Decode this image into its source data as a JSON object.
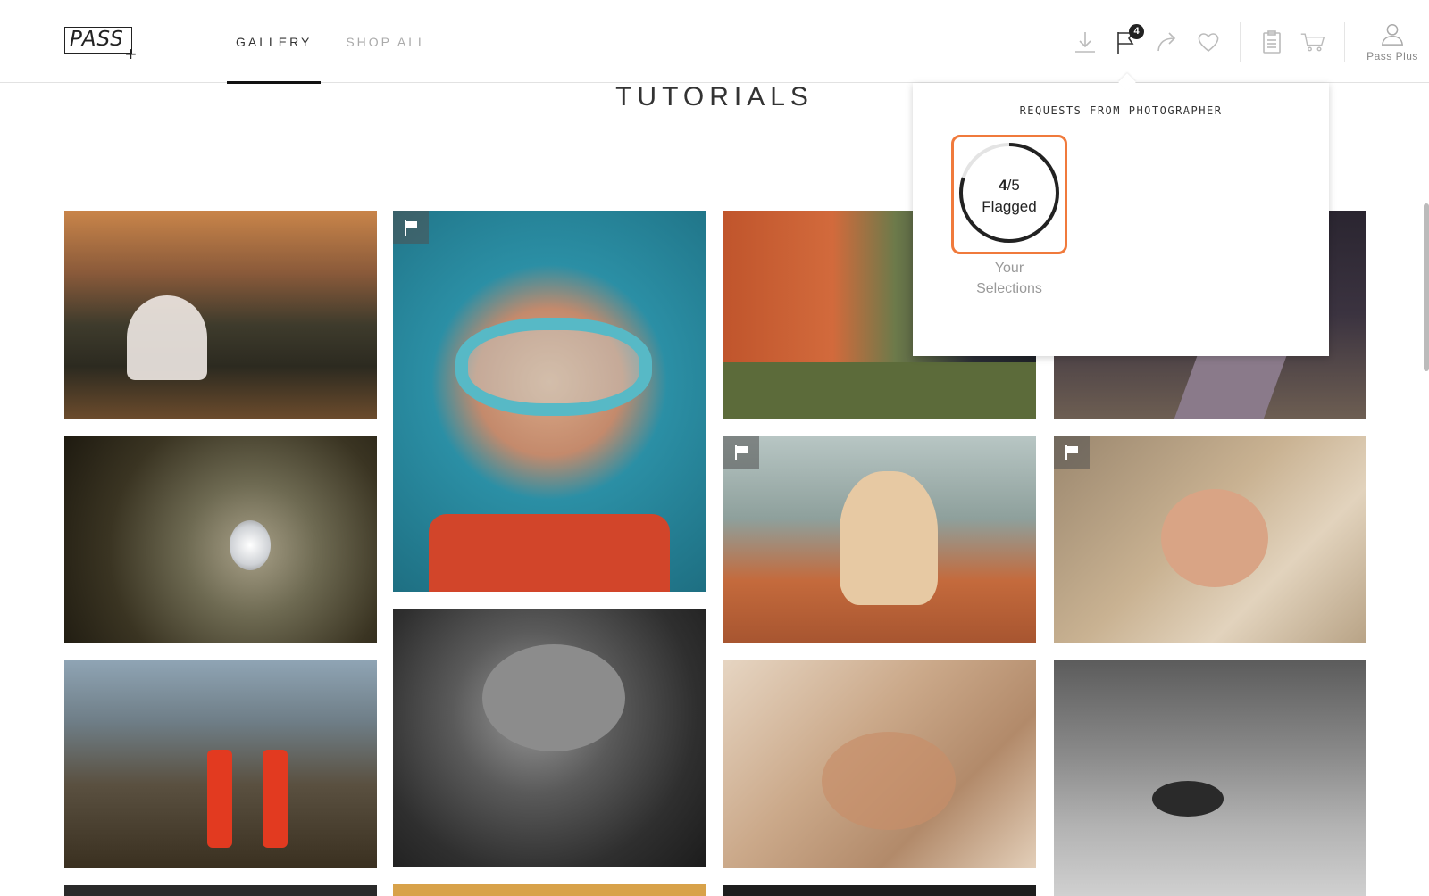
{
  "brand": {
    "logo_text": "PASS",
    "logo_plus": "+"
  },
  "nav": [
    {
      "label": "GALLERY",
      "active": true
    },
    {
      "label": "SHOP ALL",
      "active": false
    }
  ],
  "header_icons": {
    "download": "download-icon",
    "flag": "flag-icon",
    "flag_count": "4",
    "share": "share-icon",
    "favorite": "heart-icon",
    "clipboard": "clipboard-icon",
    "cart": "cart-icon",
    "user": "user-icon"
  },
  "user_label": "Pass Plus",
  "page_title": "TUTORIALS",
  "panel": {
    "heading": "REQUESTS FROM PHOTOGRAPHER",
    "flagged_current": "4",
    "flagged_total": "5",
    "flagged_sep": "/",
    "flagged_label": "Flagged",
    "flagged_fraction": 0.8,
    "caption_line1": "Your",
    "caption_line2": "Selections"
  },
  "photos": [
    {
      "name": "photo-wedding-mountain",
      "flagged": false
    },
    {
      "name": "photo-girl-goggles",
      "flagged": true
    },
    {
      "name": "photo-bridesmaids",
      "flagged": false
    },
    {
      "name": "photo-road",
      "flagged": false
    },
    {
      "name": "photo-ring",
      "flagged": false
    },
    {
      "name": "photo-woman-hat-car",
      "flagged": true
    },
    {
      "name": "photo-newborn-bonnet",
      "flagged": true
    },
    {
      "name": "photo-rain-boots",
      "flagged": false
    },
    {
      "name": "photo-newborn-hands",
      "flagged": false
    },
    {
      "name": "photo-family-bed",
      "flagged": false
    },
    {
      "name": "photo-freckled-face",
      "flagged": false
    }
  ],
  "colors": {
    "accent": "#f07a3c",
    "text": "#222222",
    "muted": "#aaaaaa"
  }
}
